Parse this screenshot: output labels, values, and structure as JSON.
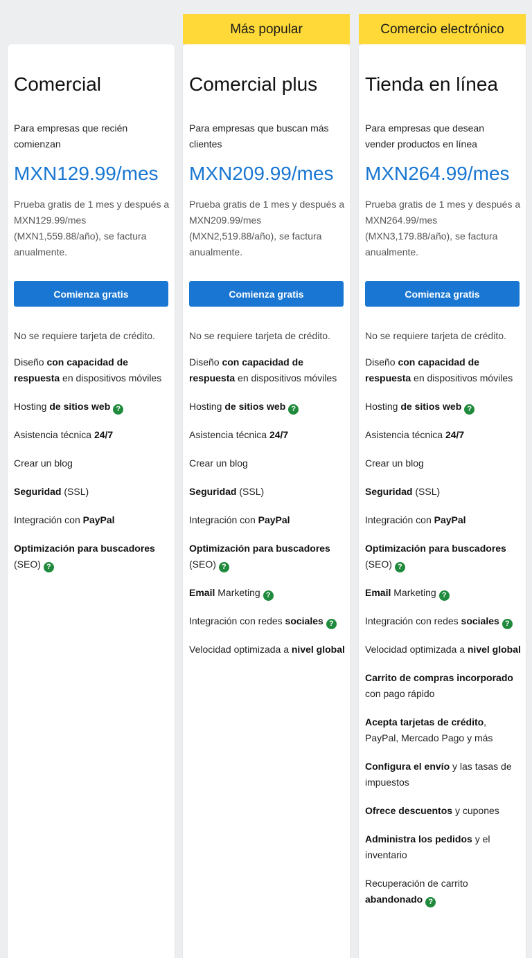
{
  "plans": [
    {
      "name": "Comercial",
      "description": "Para empresas que recién comienzan",
      "price": "MXN129.99/mes",
      "trial": "Prueba gratis de 1 mes y después a MXN129.99/mes (MXN1,559.88/año), se factura anualmente.",
      "cta_label": "Comienza gratis",
      "no_card": "No se requiere tarjeta de crédito.",
      "features": [
        {
          "parts": [
            [
              "Diseño ",
              0
            ],
            [
              "con capacidad de respuesta",
              1
            ],
            [
              " en dispositivos móviles",
              0
            ]
          ],
          "help": false
        },
        {
          "parts": [
            [
              "Hosting ",
              0
            ],
            [
              "de sitios web",
              1
            ]
          ],
          "help": true
        },
        {
          "parts": [
            [
              "Asistencia técnica ",
              0
            ],
            [
              "24/7",
              1
            ]
          ],
          "help": false
        },
        {
          "parts": [
            [
              "Crear un blog",
              0
            ]
          ],
          "help": false
        },
        {
          "parts": [
            [
              "Seguridad",
              1
            ],
            [
              " (SSL)",
              0
            ]
          ],
          "help": false
        },
        {
          "parts": [
            [
              "Integración con ",
              0
            ],
            [
              "PayPal",
              1
            ]
          ],
          "help": false
        },
        {
          "parts": [
            [
              "Optimización para buscadores",
              1
            ],
            [
              " (SEO)",
              0
            ]
          ],
          "help": true
        }
      ]
    },
    {
      "badge": "Más popular",
      "name": "Comercial plus",
      "description": "Para empresas que buscan más clientes",
      "price": "MXN209.99/mes",
      "trial": "Prueba gratis de 1 mes y después a MXN209.99/mes (MXN2,519.88/año), se factura anualmente.",
      "cta_label": "Comienza gratis",
      "no_card": "No se requiere tarjeta de crédito.",
      "features": [
        {
          "parts": [
            [
              "Diseño ",
              0
            ],
            [
              "con capacidad de respuesta",
              1
            ],
            [
              " en dispositivos móviles",
              0
            ]
          ],
          "help": false
        },
        {
          "parts": [
            [
              "Hosting ",
              0
            ],
            [
              "de sitios web",
              1
            ]
          ],
          "help": true
        },
        {
          "parts": [
            [
              "Asistencia técnica ",
              0
            ],
            [
              "24/7",
              1
            ]
          ],
          "help": false
        },
        {
          "parts": [
            [
              "Crear un blog",
              0
            ]
          ],
          "help": false
        },
        {
          "parts": [
            [
              "Seguridad",
              1
            ],
            [
              " (SSL)",
              0
            ]
          ],
          "help": false
        },
        {
          "parts": [
            [
              "Integración con ",
              0
            ],
            [
              "PayPal",
              1
            ]
          ],
          "help": false
        },
        {
          "parts": [
            [
              "Optimización para buscadores",
              1
            ],
            [
              " (SEO)",
              0
            ]
          ],
          "help": true
        },
        {
          "parts": [
            [
              "Email",
              1
            ],
            [
              " Marketing",
              0
            ]
          ],
          "help": true
        },
        {
          "parts": [
            [
              "Integración con redes ",
              0
            ],
            [
              "sociales",
              1
            ]
          ],
          "help": true
        },
        {
          "parts": [
            [
              "Velocidad optimizada a ",
              0
            ],
            [
              "nivel global",
              1
            ]
          ],
          "help": false
        }
      ]
    },
    {
      "badge": "Comercio electrónico",
      "name": "Tienda en línea",
      "description": "Para empresas que desean vender productos en línea",
      "price": "MXN264.99/mes",
      "trial": "Prueba gratis de 1 mes y después a MXN264.99/mes (MXN3,179.88/año), se factura anualmente.",
      "cta_label": "Comienza gratis",
      "no_card": "No se requiere tarjeta de crédito.",
      "features": [
        {
          "parts": [
            [
              "Diseño ",
              0
            ],
            [
              "con capacidad de respuesta",
              1
            ],
            [
              " en dispositivos móviles",
              0
            ]
          ],
          "help": false
        },
        {
          "parts": [
            [
              "Hosting ",
              0
            ],
            [
              "de sitios web",
              1
            ]
          ],
          "help": true
        },
        {
          "parts": [
            [
              "Asistencia técnica ",
              0
            ],
            [
              "24/7",
              1
            ]
          ],
          "help": false
        },
        {
          "parts": [
            [
              "Crear un blog",
              0
            ]
          ],
          "help": false
        },
        {
          "parts": [
            [
              "Seguridad",
              1
            ],
            [
              " (SSL)",
              0
            ]
          ],
          "help": false
        },
        {
          "parts": [
            [
              "Integración con ",
              0
            ],
            [
              "PayPal",
              1
            ]
          ],
          "help": false
        },
        {
          "parts": [
            [
              "Optimización para buscadores",
              1
            ],
            [
              " (SEO)",
              0
            ]
          ],
          "help": true
        },
        {
          "parts": [
            [
              "Email",
              1
            ],
            [
              " Marketing",
              0
            ]
          ],
          "help": true
        },
        {
          "parts": [
            [
              "Integración con redes ",
              0
            ],
            [
              "sociales",
              1
            ]
          ],
          "help": true
        },
        {
          "parts": [
            [
              "Velocidad optimizada a ",
              0
            ],
            [
              "nivel global",
              1
            ]
          ],
          "help": false
        },
        {
          "parts": [
            [
              "Carrito de compras incorporado",
              1
            ],
            [
              " con pago rápido",
              0
            ]
          ],
          "help": false
        },
        {
          "parts": [
            [
              "Acepta tarjetas de crédito",
              1
            ],
            [
              ", PayPal, Mercado Pago y más",
              0
            ]
          ],
          "help": false
        },
        {
          "parts": [
            [
              "Configura el envío",
              1
            ],
            [
              " y las tasas de impuestos",
              0
            ]
          ],
          "help": false
        },
        {
          "parts": [
            [
              "Ofrece descuentos",
              1
            ],
            [
              " y cupones",
              0
            ]
          ],
          "help": false
        },
        {
          "parts": [
            [
              "Administra los pedidos",
              1
            ],
            [
              " y el inventario",
              0
            ]
          ],
          "help": false
        },
        {
          "parts": [
            [
              "Recuperación de carrito ",
              0
            ],
            [
              "abandonado",
              1
            ]
          ],
          "help": true
        }
      ]
    }
  ],
  "help_icon_glyph": "?",
  "help_icon_color": "#1f8a3b",
  "accent_color": "#1976d2",
  "badge_color": "#fed937"
}
